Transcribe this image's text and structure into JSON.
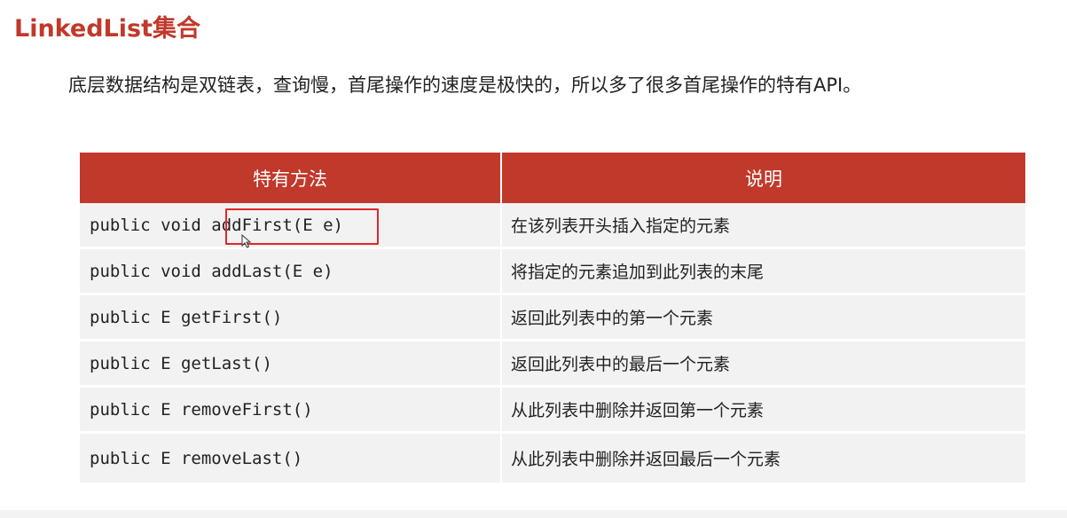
{
  "slide": {
    "title": "LinkedList集合",
    "description": "底层数据结构是双链表，查询慢，首尾操作的速度是极快的，所以多了很多首尾操作的特有API。"
  },
  "table": {
    "headers": {
      "method": "特有方法",
      "description": "说明"
    },
    "rows": [
      {
        "method": "public void addFirst(E e)",
        "description": "在该列表开头插入指定的元素"
      },
      {
        "method": "public void addLast(E e)",
        "description": "将指定的元素追加到此列表的末尾"
      },
      {
        "method": "public E getFirst()",
        "description": "返回此列表中的第一个元素"
      },
      {
        "method": "public E getLast()",
        "description": "返回此列表中的最后一个元素"
      },
      {
        "method": "public E removeFirst()",
        "description": "从此列表中删除并返回第一个元素"
      },
      {
        "method": "public E removeLast()",
        "description": "从此列表中删除并返回最后一个元素"
      }
    ]
  },
  "colors": {
    "accent": "#c0392b",
    "highlight": "#e3262b",
    "row_background": "#f2f2f2"
  },
  "icons": {
    "cursor": "mouse-pointer-icon"
  }
}
